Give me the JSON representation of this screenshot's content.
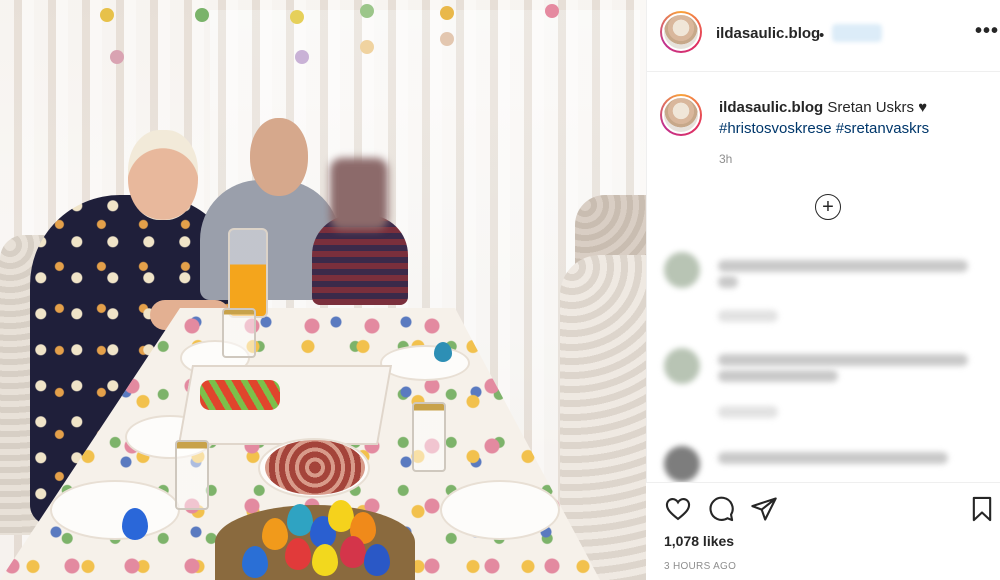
{
  "post": {
    "username": "ildasaulic.blog",
    "header_separator": "•",
    "more_label": "•••"
  },
  "caption": {
    "username": "ildasaulic.blog",
    "text": "Sretan Uskrs",
    "heart": "♥",
    "hashtags": "#hristosvoskrese #sretanvaskrs",
    "time": "3h"
  },
  "load_more": {
    "symbol": "+",
    "icon": "plus-circle-icon"
  },
  "actions": {
    "like_icon": "heart-outline-icon",
    "comment_icon": "comment-bubble-icon",
    "share_icon": "paper-plane-icon",
    "save_icon": "bookmark-icon"
  },
  "stats": {
    "likes": "1,078 likes",
    "time_ago": "3 HOURS AGO"
  },
  "colors": {
    "text": "#262626",
    "secondary": "#8e8e8e",
    "hashtag": "#00376b",
    "border": "#efefef"
  }
}
